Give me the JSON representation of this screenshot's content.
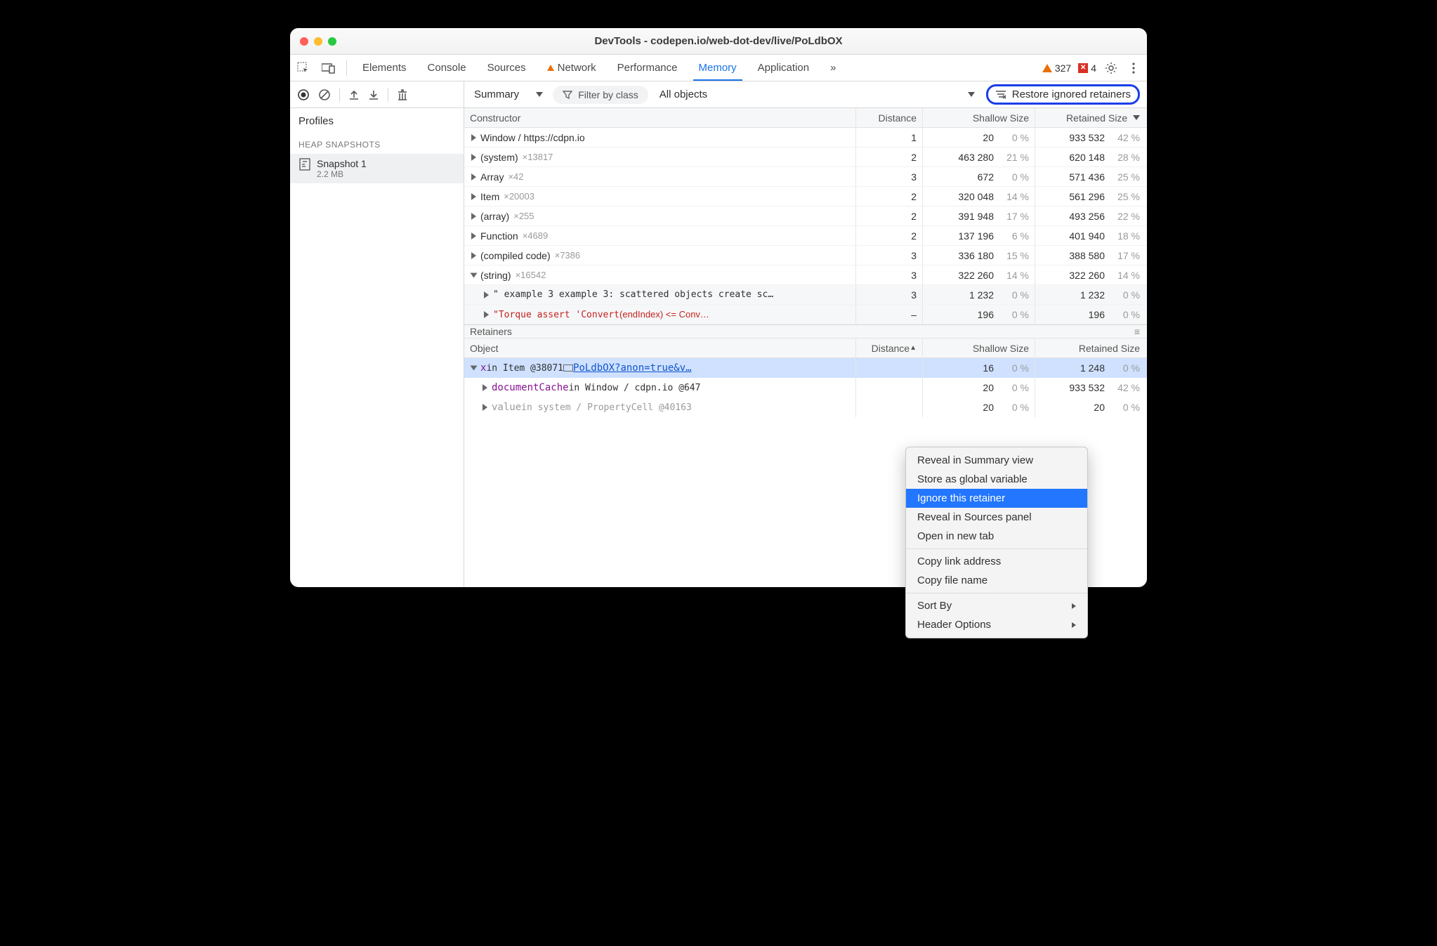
{
  "window": {
    "title": "DevTools - codepen.io/web-dot-dev/live/PoLdbOX"
  },
  "tabs": [
    "Elements",
    "Console",
    "Sources",
    "Network",
    "Performance",
    "Memory",
    "Application"
  ],
  "active_tab": "Memory",
  "warnings_count": "327",
  "errors_count": "4",
  "sidebar": {
    "profiles_title": "Profiles",
    "section": "HEAP SNAPSHOTS",
    "snapshot_name": "Snapshot 1",
    "snapshot_size": "2.2 MB"
  },
  "toolbar": {
    "summary_label": "Summary",
    "filter_placeholder": "Filter by class",
    "all_objects": "All objects",
    "restore_label": "Restore ignored retainers"
  },
  "headers": {
    "constructor": "Constructor",
    "distance": "Distance",
    "shallow": "Shallow Size",
    "retained": "Retained Size",
    "object": "Object"
  },
  "rows": [
    {
      "name": "Window / https://cdpn.io",
      "count": "",
      "dist": "1",
      "shallow": "20",
      "shallow_pct": "0 %",
      "retained": "933 532",
      "retained_pct": "42 %",
      "indent": 0,
      "open": false
    },
    {
      "name": "(system)",
      "count": "×13817",
      "dist": "2",
      "shallow": "463 280",
      "shallow_pct": "21 %",
      "retained": "620 148",
      "retained_pct": "28 %",
      "indent": 0,
      "open": false
    },
    {
      "name": "Array",
      "count": "×42",
      "dist": "3",
      "shallow": "672",
      "shallow_pct": "0 %",
      "retained": "571 436",
      "retained_pct": "25 %",
      "indent": 0,
      "open": false
    },
    {
      "name": "Item",
      "count": "×20003",
      "dist": "2",
      "shallow": "320 048",
      "shallow_pct": "14 %",
      "retained": "561 296",
      "retained_pct": "25 %",
      "indent": 0,
      "open": false
    },
    {
      "name": "(array)",
      "count": "×255",
      "dist": "2",
      "shallow": "391 948",
      "shallow_pct": "17 %",
      "retained": "493 256",
      "retained_pct": "22 %",
      "indent": 0,
      "open": false
    },
    {
      "name": "Function",
      "count": "×4689",
      "dist": "2",
      "shallow": "137 196",
      "shallow_pct": "6 %",
      "retained": "401 940",
      "retained_pct": "18 %",
      "indent": 0,
      "open": false
    },
    {
      "name": "(compiled code)",
      "count": "×7386",
      "dist": "3",
      "shallow": "336 180",
      "shallow_pct": "15 %",
      "retained": "388 580",
      "retained_pct": "17 %",
      "indent": 0,
      "open": false
    },
    {
      "name": "(string)",
      "count": "×16542",
      "dist": "3",
      "shallow": "322 260",
      "shallow_pct": "14 %",
      "retained": "322 260",
      "retained_pct": "14 %",
      "indent": 0,
      "open": true
    }
  ],
  "child_rows": [
    {
      "text": "\" example 3 example 3: scattered objects create sc…",
      "dist": "3",
      "shallow": "1 232",
      "shallow_pct": "0 %",
      "retained": "1 232",
      "retained_pct": "0 %",
      "red": false
    },
    {
      "text": "\"Torque assert 'Convert<uintptr>(endIndex) <= Conv…",
      "dist": "–",
      "shallow": "196",
      "shallow_pct": "0 %",
      "retained": "196",
      "retained_pct": "0 %",
      "red": true
    }
  ],
  "retainers_title": "Retainers",
  "retainers": [
    {
      "prop": "x",
      "mid": " in Item @38071 ",
      "link": "PoLdbOX?anon=true&v…",
      "dist": "",
      "shallow": "16",
      "shallow_pct": "0 %",
      "retained": "1 248",
      "retained_pct": "0 %",
      "sel": true,
      "open": true,
      "indent": 0
    },
    {
      "prop": "documentCache",
      "mid": " in Window / cdpn.io @647",
      "link": "",
      "dist": "",
      "shallow": "20",
      "shallow_pct": "0 %",
      "retained": "933 532",
      "retained_pct": "42 %",
      "sel": false,
      "open": false,
      "indent": 1
    },
    {
      "prop": "value",
      "mid": " in system / PropertyCell @40163",
      "link": "",
      "dist": "",
      "shallow": "20",
      "shallow_pct": "0 %",
      "retained": "20",
      "retained_pct": "0 %",
      "sel": false,
      "open": false,
      "gray": true,
      "indent": 1
    }
  ],
  "context_menu": {
    "items": [
      "Reveal in Summary view",
      "Store as global variable",
      "Ignore this retainer",
      "Reveal in Sources panel",
      "Open in new tab"
    ],
    "highlighted": "Ignore this retainer",
    "items2": [
      "Copy link address",
      "Copy file name"
    ],
    "items3": [
      "Sort By",
      "Header Options"
    ]
  }
}
